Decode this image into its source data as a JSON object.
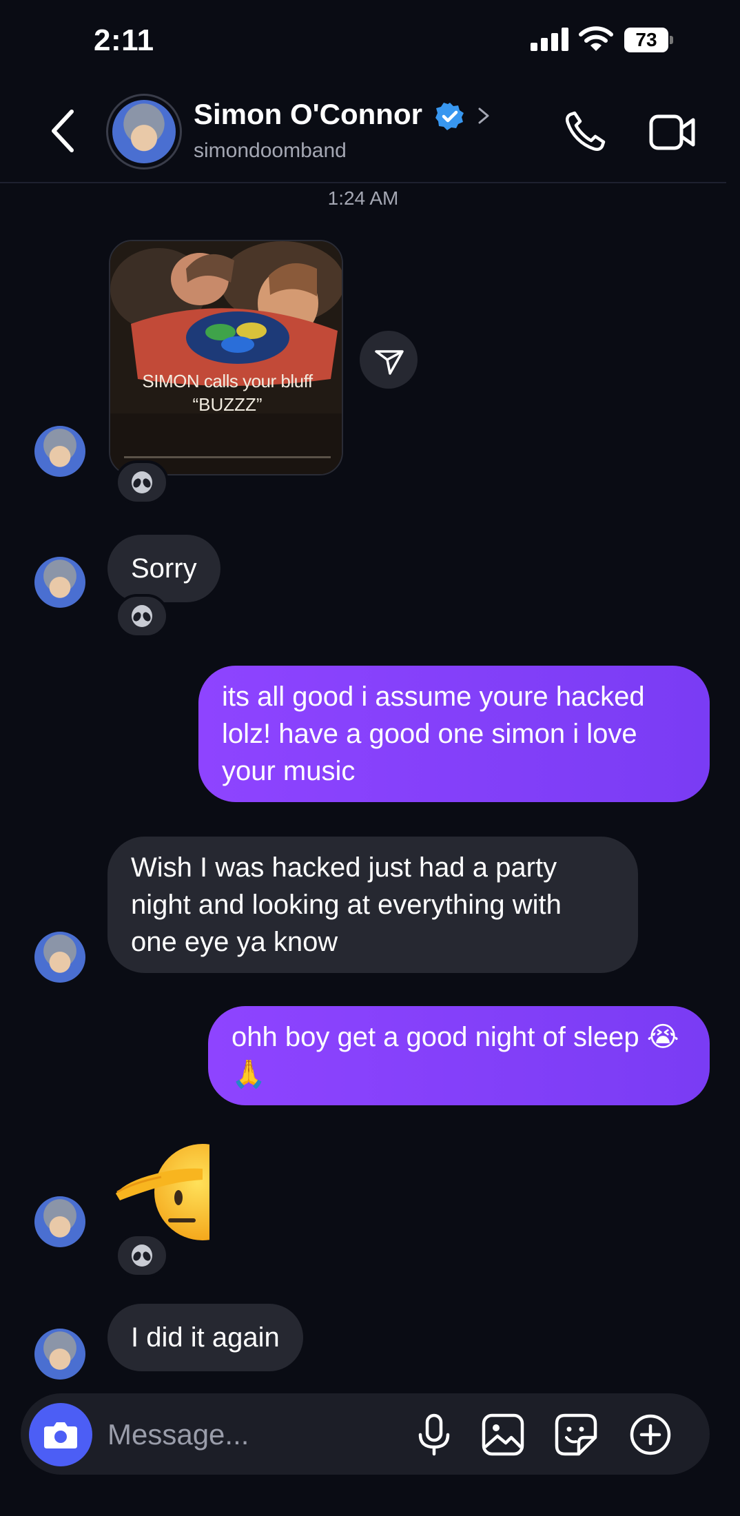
{
  "status_bar": {
    "time": "2:11",
    "battery": "73"
  },
  "header": {
    "name": "Simon O'Connor",
    "username": "simondoomband"
  },
  "timestamp": "1:24 AM",
  "photo": {
    "line1": "SIMON calls your bluff",
    "line2": "“BUZZZ”"
  },
  "messages": {
    "sorry": "Sorry",
    "its_all_good": "its all good i assume youre hacked lolz! have a good one simon i love your music",
    "wish_hacked": "Wish I was hacked just had a party night and looking at everything with one eye ya know",
    "good_night": "ohh boy get a good night of sleep 😭🙏",
    "salute": "🫡",
    "did_it_again": "I did it again"
  },
  "composer": {
    "placeholder": "Message..."
  },
  "colors": {
    "background": "#0a0c14",
    "incoming_bubble": "#262831",
    "outgoing_bubble": "#8a44fb",
    "camera_button": "#4c5ef5",
    "verified": "#3897f0"
  }
}
